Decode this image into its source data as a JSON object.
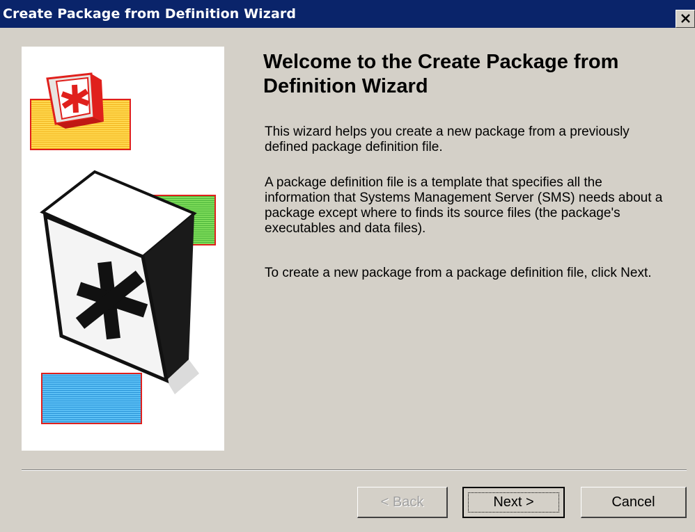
{
  "window": {
    "title": "Create Package from Definition Wizard",
    "close_icon": "close-icon"
  },
  "content": {
    "heading": "Welcome to the Create Package from Definition Wizard",
    "paragraphs": [
      "This wizard helps you create a new package from a previously defined package definition file.",
      "A package definition file is a template that specifies all the information that Systems Management Server (SMS) needs about a package except where to finds its source files (the package's executables and data files).",
      "To create a new package from a package definition file, click Next."
    ]
  },
  "buttons": {
    "back": "< Back",
    "next": "Next >",
    "cancel": "Cancel"
  },
  "colors": {
    "titlebar": "#0a246a",
    "dialog_bg": "#d4d0c8",
    "art_yellow": "#ffd24a",
    "art_green": "#6ed24e",
    "art_blue": "#45b4f0",
    "art_red": "#e0201c"
  }
}
